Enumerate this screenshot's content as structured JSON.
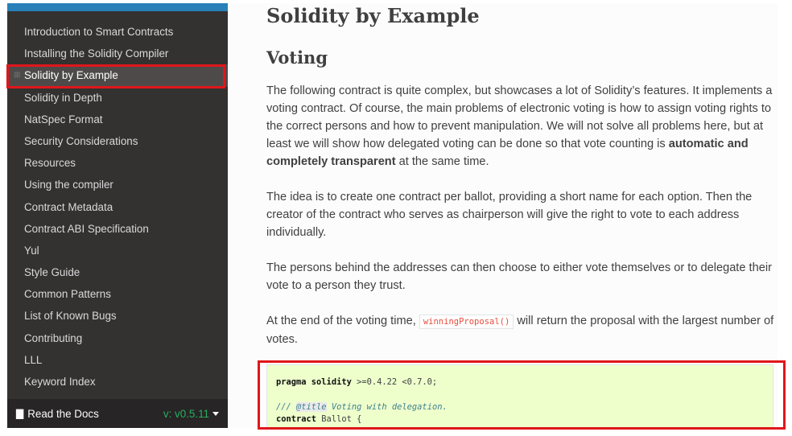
{
  "sidebar": {
    "items": [
      {
        "label": "Introduction to Smart Contracts"
      },
      {
        "label": "Installing the Solidity Compiler"
      },
      {
        "label": "Solidity by Example",
        "current": true
      },
      {
        "label": "Solidity in Depth"
      },
      {
        "label": "NatSpec Format"
      },
      {
        "label": "Security Considerations"
      },
      {
        "label": "Resources"
      },
      {
        "label": "Using the compiler"
      },
      {
        "label": "Contract Metadata"
      },
      {
        "label": "Contract ABI Specification"
      },
      {
        "label": "Yul"
      },
      {
        "label": "Style Guide"
      },
      {
        "label": "Common Patterns"
      },
      {
        "label": "List of Known Bugs"
      },
      {
        "label": "Contributing"
      },
      {
        "label": "LLL"
      },
      {
        "label": "Keyword Index"
      }
    ],
    "footer": {
      "read_the_docs": "Read the Docs",
      "version": "v: v0.5.11"
    }
  },
  "page": {
    "title": "Solidity by Example",
    "section_title": "Voting",
    "para1_text": "The following contract is quite complex, but showcases a lot of Solidity’s features. It implements a voting contract. Of course, the main problems of electronic voting is how to assign voting rights to the correct persons and how to prevent manipulation. We will not solve all problems here, but at least we will show how delegated voting can be done so that vote counting is ",
    "para1_bold": "automatic and completely transparent",
    "para1_end": " at the same time.",
    "para2": "The idea is to create one contract per ballot, providing a short name for each option. Then the creator of the contract who serves as chairperson will give the right to vote to each address individually.",
    "para3": "The persons behind the addresses can then choose to either vote themselves or to delegate their vote to a person they trust.",
    "para4_start": "At the end of the voting time, ",
    "para4_code": "winningProposal()",
    "para4_end": " will return the proposal with the largest number of votes."
  },
  "code": {
    "line1_kw": "pragma solidity",
    "line1_rest": " >=0.4.22 <0.7.0;",
    "line3_prefix": "/// ",
    "line3_tag": "@title",
    "line3_rest": " Voting with delegation.",
    "line4_kw": "contract",
    "line4_rest": " Ballot {"
  },
  "colors": {
    "sidebar_bg": "#343131",
    "accent_blue": "#2980b9",
    "version_green": "#27ae60",
    "highlight_red": "#e0161b",
    "code_bg": "#eeffcc"
  }
}
